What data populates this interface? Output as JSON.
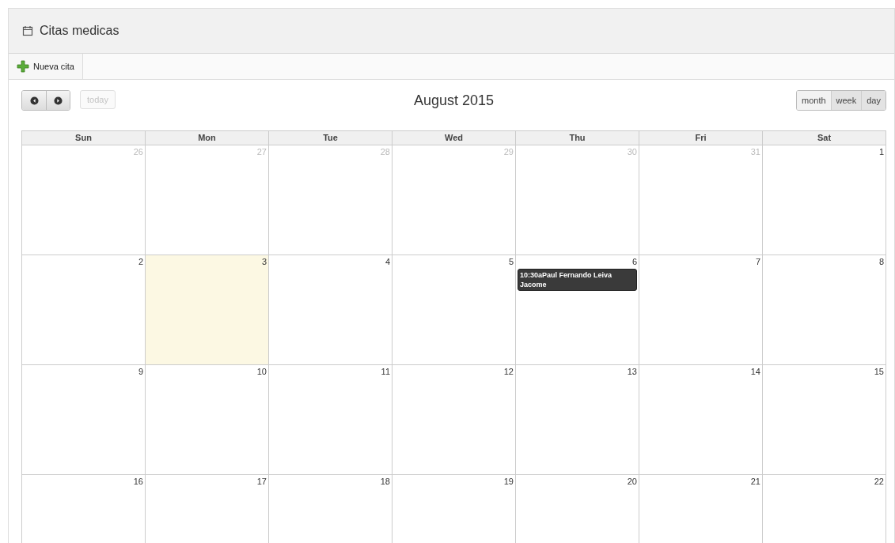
{
  "panel": {
    "title": "Citas medicas"
  },
  "toolbar": {
    "buttons": [
      {
        "label": "Nueva cita"
      }
    ]
  },
  "calendar": {
    "title": "August 2015",
    "today_label": "today",
    "today_disabled": true,
    "views": [
      {
        "label": "month",
        "selected": true
      },
      {
        "label": "week",
        "selected": false
      },
      {
        "label": "day",
        "selected": false
      }
    ],
    "weekdays": [
      "Sun",
      "Mon",
      "Tue",
      "Wed",
      "Thu",
      "Fri",
      "Sat"
    ],
    "weeks": [
      [
        {
          "day": "26",
          "other_month": true,
          "today": false
        },
        {
          "day": "27",
          "other_month": true,
          "today": false
        },
        {
          "day": "28",
          "other_month": true,
          "today": false
        },
        {
          "day": "29",
          "other_month": true,
          "today": false
        },
        {
          "day": "30",
          "other_month": true,
          "today": false
        },
        {
          "day": "31",
          "other_month": true,
          "today": false
        },
        {
          "day": "1",
          "other_month": false,
          "today": false
        }
      ],
      [
        {
          "day": "2",
          "other_month": false,
          "today": false
        },
        {
          "day": "3",
          "other_month": false,
          "today": true
        },
        {
          "day": "4",
          "other_month": false,
          "today": false
        },
        {
          "day": "5",
          "other_month": false,
          "today": false
        },
        {
          "day": "6",
          "other_month": false,
          "today": false,
          "events": [
            {
              "time": "10:30a",
              "title": "Paul Fernando Leiva Jacome"
            }
          ]
        },
        {
          "day": "7",
          "other_month": false,
          "today": false
        },
        {
          "day": "8",
          "other_month": false,
          "today": false
        }
      ],
      [
        {
          "day": "9",
          "other_month": false,
          "today": false
        },
        {
          "day": "10",
          "other_month": false,
          "today": false
        },
        {
          "day": "11",
          "other_month": false,
          "today": false
        },
        {
          "day": "12",
          "other_month": false,
          "today": false
        },
        {
          "day": "13",
          "other_month": false,
          "today": false
        },
        {
          "day": "14",
          "other_month": false,
          "today": false
        },
        {
          "day": "15",
          "other_month": false,
          "today": false
        }
      ],
      [
        {
          "day": "16",
          "other_month": false,
          "today": false
        },
        {
          "day": "17",
          "other_month": false,
          "today": false
        },
        {
          "day": "18",
          "other_month": false,
          "today": false
        },
        {
          "day": "19",
          "other_month": false,
          "today": false
        },
        {
          "day": "20",
          "other_month": false,
          "today": false
        },
        {
          "day": "21",
          "other_month": false,
          "today": false
        },
        {
          "day": "22",
          "other_month": false,
          "today": false
        }
      ]
    ]
  }
}
